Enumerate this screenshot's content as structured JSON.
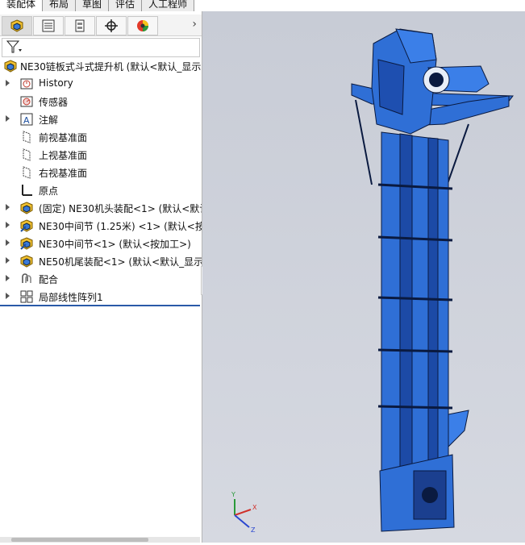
{
  "tabs": [
    "装配体",
    "布局",
    "草图",
    "评估",
    "人工程师"
  ],
  "filter_icon": "filter-icon",
  "root": {
    "label": "NE30链板式斗式提升机 (默认<默认_显示"
  },
  "tree": [
    {
      "label": "History",
      "icon": "history-icon",
      "expandable": true
    },
    {
      "label": "传感器",
      "icon": "sensor-icon",
      "expandable": false
    },
    {
      "label": "注解",
      "icon": "annotation-icon",
      "expandable": true
    },
    {
      "label": "前视基准面",
      "icon": "plane-icon",
      "expandable": false
    },
    {
      "label": "上视基准面",
      "icon": "plane-icon",
      "expandable": false
    },
    {
      "label": "右视基准面",
      "icon": "plane-icon",
      "expandable": false
    },
    {
      "label": "原点",
      "icon": "origin-icon",
      "expandable": false
    },
    {
      "label": "(固定) NE30机头装配<1> (默认<默认",
      "icon": "subassembly-icon",
      "expandable": true
    },
    {
      "label": "NE30中间节 (1.25米) <1> (默认<按",
      "icon": "subassembly-icon",
      "expandable": true
    },
    {
      "label": "NE30中间节<1> (默认<按加工>)",
      "icon": "subassembly-icon",
      "expandable": true
    },
    {
      "label": "NE50机尾装配<1> (默认<默认_显示",
      "icon": "subassembly-icon",
      "expandable": true
    },
    {
      "label": "配合",
      "icon": "mates-icon",
      "expandable": true
    },
    {
      "label": "局部线性阵列1",
      "icon": "linear-pattern-icon",
      "expandable": true
    }
  ],
  "colors": {
    "accent": "#2a5aa8",
    "model": "#2f6fd6"
  }
}
